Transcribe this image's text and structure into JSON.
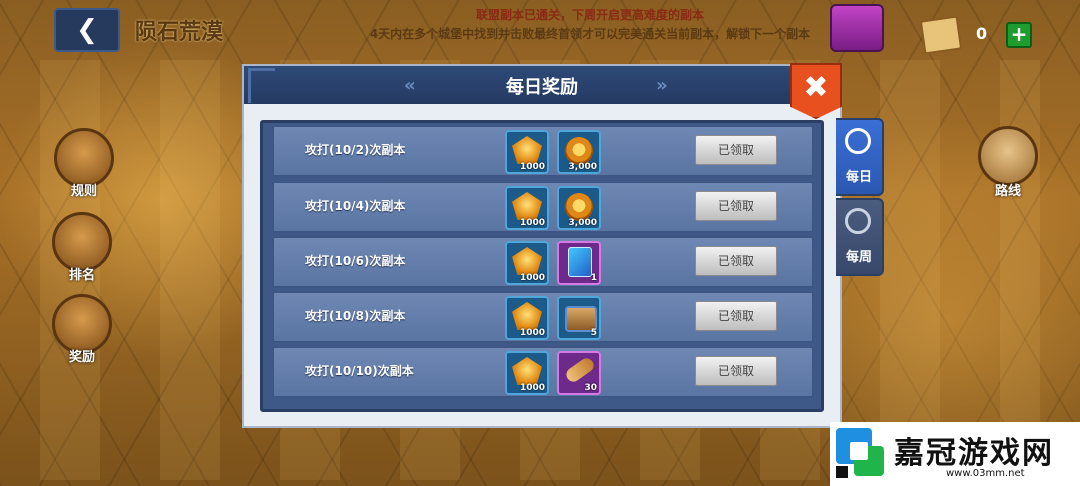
{
  "header": {
    "back_icon": "back-arrow-icon",
    "level_title": "陨石荒漠",
    "notice_line1": "联盟副本已通关，下周开启更高难度的副本",
    "notice_line2": "4天内在多个城堡中找到并击败最终首领才可以完美通关当前副本，解锁下一个副本",
    "resource_count": "0",
    "plus_label": "+"
  },
  "sidebar": {
    "rules": "规则",
    "ranking": "排名",
    "rewards": "奖励",
    "route": "路线"
  },
  "dialog": {
    "title": "每日奖励",
    "prev_arrow": "«",
    "next_arrow": "»",
    "close_glyph": "✖",
    "rows": [
      {
        "label": "攻打(10/2)次副本",
        "rewards": [
          {
            "icon": "gem-icon",
            "qty": "1000"
          },
          {
            "icon": "coin-icon",
            "qty": "3,000"
          }
        ],
        "button": "已领取"
      },
      {
        "label": "攻打(10/4)次副本",
        "rewards": [
          {
            "icon": "gem-icon",
            "qty": "1000"
          },
          {
            "icon": "coin-icon",
            "qty": "3,000"
          }
        ],
        "button": "已领取"
      },
      {
        "label": "攻打(10/6)次副本",
        "rewards": [
          {
            "icon": "gem-icon",
            "qty": "1000"
          },
          {
            "icon": "card-icon",
            "qty": "1"
          }
        ],
        "button": "已领取"
      },
      {
        "label": "攻打(10/8)次副本",
        "rewards": [
          {
            "icon": "gem-icon",
            "qty": "1000"
          },
          {
            "icon": "chest-icon",
            "qty": "5"
          }
        ],
        "button": "已领取"
      },
      {
        "label": "攻打(10/10)次副本",
        "rewards": [
          {
            "icon": "gem-icon",
            "qty": "1000"
          },
          {
            "icon": "scroll-icon",
            "qty": "30"
          }
        ],
        "button": "已领取"
      }
    ]
  },
  "tabs": {
    "daily": "每日",
    "weekly": "每周"
  },
  "watermark": {
    "name": "嘉冠游戏网",
    "url": "www.03mm.net"
  }
}
